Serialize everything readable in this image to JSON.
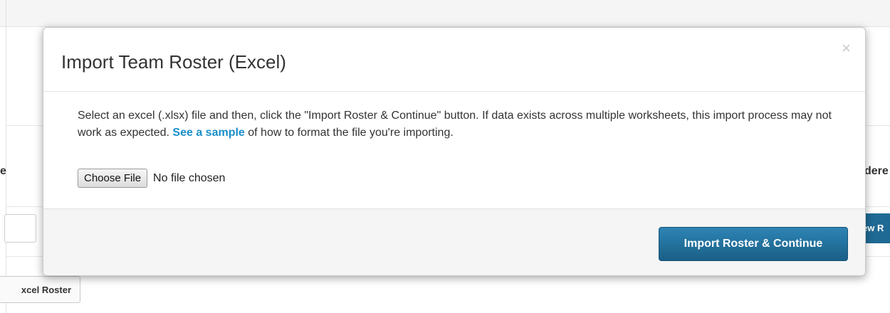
{
  "background": {
    "header_left": "e",
    "header_right": "dere",
    "right_button_label": "ew R",
    "excel_button_label": "xcel Roster"
  },
  "modal": {
    "title": "Import Team Roster (Excel)",
    "close_glyph": "×",
    "description_before_link": "Select an excel (.xlsx) file and then, click the \"Import Roster & Continue\" button. If data exists across multiple worksheets, this import process may not work as expected. ",
    "link_text": "See a sample",
    "description_after_link": " of how to format the file you're importing.",
    "file_input": {
      "button_label": "Choose File",
      "status": "No file chosen"
    },
    "primary_button_label": "Import Roster & Continue"
  },
  "colors": {
    "link": "#1a8ec9",
    "primary_button": "#1f6a94"
  }
}
